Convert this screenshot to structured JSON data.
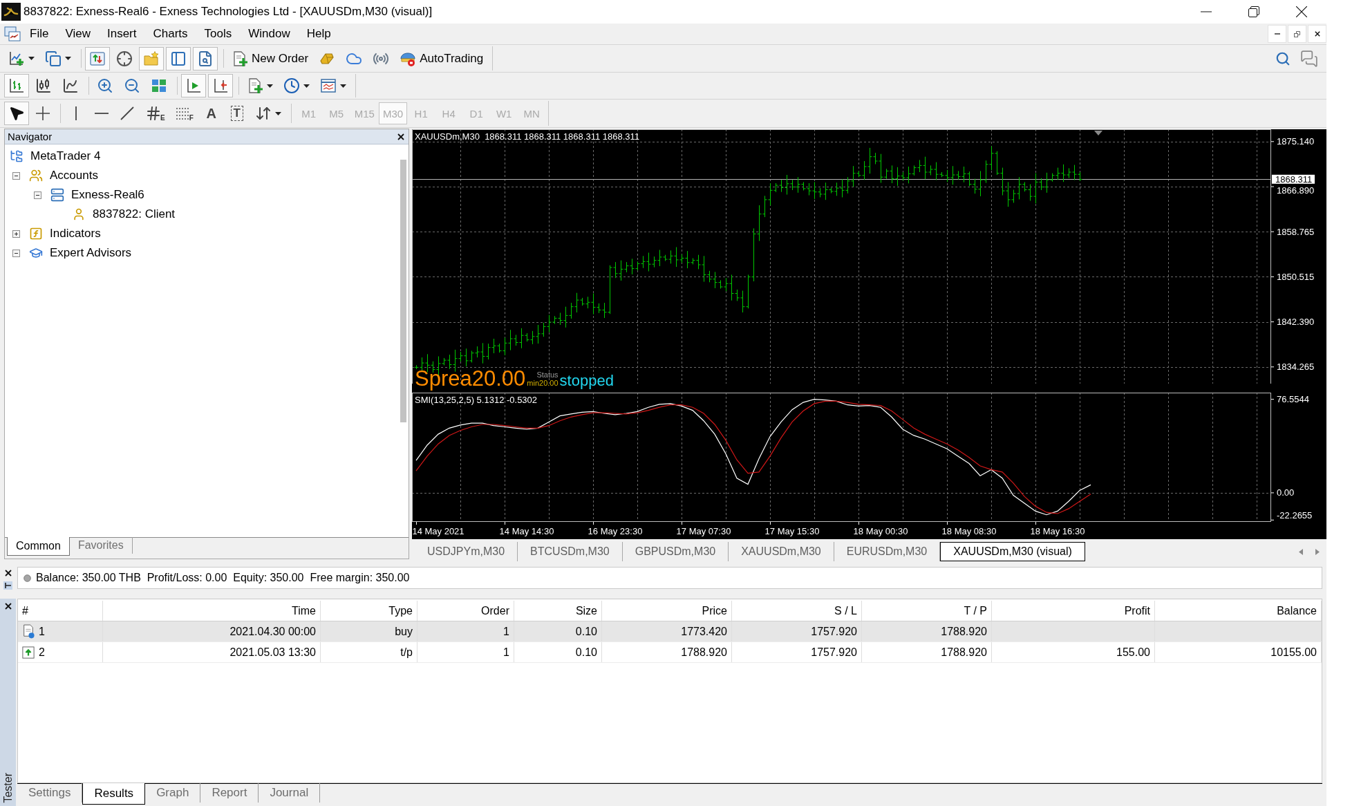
{
  "window": {
    "title": "8837822: Exness-Real6 - Exness Technologies Ltd - [XAUUSDm,M30 (visual)]"
  },
  "menu": [
    "File",
    "View",
    "Insert",
    "Charts",
    "Tools",
    "Window",
    "Help"
  ],
  "toolbars": [
    {
      "groups": [
        [
          {
            "kind": "icon",
            "pressed": false,
            "menu": true
          },
          {
            "kind": "icon",
            "pressed": false,
            "menu": true
          }
        ],
        [
          {
            "kind": "icon",
            "pressed": true
          },
          {
            "kind": "icon",
            "pressed": false
          },
          {
            "kind": "icon",
            "pressed": true
          },
          {
            "kind": "icon",
            "pressed": true
          },
          {
            "kind": "icon",
            "pressed": true
          }
        ],
        [
          {
            "kind": "text",
            "label": "New Order",
            "pressed": false
          },
          {
            "kind": "icon",
            "pressed": false
          },
          {
            "kind": "icon",
            "pressed": false
          },
          {
            "kind": "icon",
            "pressed": false
          },
          {
            "kind": "text",
            "label": "AutoTrading",
            "pressed": false
          }
        ]
      ]
    },
    {
      "groups": [
        [
          {
            "kind": "icon",
            "pressed": true
          },
          {
            "kind": "icon",
            "pressed": false
          },
          {
            "kind": "icon",
            "pressed": false
          }
        ],
        [
          {
            "kind": "icon",
            "pressed": false
          },
          {
            "kind": "icon",
            "pressed": false
          },
          {
            "kind": "icon",
            "pressed": false
          }
        ],
        [
          {
            "kind": "icon",
            "pressed": true
          },
          {
            "kind": "icon",
            "pressed": true
          }
        ],
        [
          {
            "kind": "icon",
            "pressed": false,
            "menu": true
          },
          {
            "kind": "icon",
            "pressed": false,
            "menu": true
          },
          {
            "kind": "icon",
            "pressed": false,
            "menu": true
          }
        ]
      ]
    },
    {
      "groups": [
        [
          {
            "kind": "icon",
            "pressed": true
          },
          {
            "kind": "icon",
            "pressed": false
          }
        ],
        [
          {
            "kind": "icon",
            "pressed": false
          },
          {
            "kind": "icon",
            "pressed": false
          },
          {
            "kind": "icon",
            "pressed": false
          },
          {
            "kind": "sub",
            "label": "E",
            "pressed": false
          },
          {
            "kind": "sub",
            "label": "F",
            "pressed": false
          },
          {
            "kind": "glyph",
            "label": "A",
            "pressed": false
          },
          {
            "kind": "boxed",
            "label": "T",
            "pressed": false
          },
          {
            "kind": "icon",
            "pressed": false,
            "menu": true
          }
        ]
      ],
      "timeframes": [
        {
          "label": "M1",
          "selected": false,
          "disabled": true
        },
        {
          "label": "M5",
          "selected": false,
          "disabled": true
        },
        {
          "label": "M15",
          "selected": false,
          "disabled": true
        },
        {
          "label": "M30",
          "selected": true,
          "disabled": true
        },
        {
          "label": "H1",
          "selected": false,
          "disabled": true
        },
        {
          "label": "H4",
          "selected": false,
          "disabled": true
        },
        {
          "label": "D1",
          "selected": false,
          "disabled": true
        },
        {
          "label": "W1",
          "selected": false,
          "disabled": true
        },
        {
          "label": "MN",
          "selected": false,
          "disabled": true
        }
      ]
    }
  ],
  "navigator": {
    "title": "Navigator",
    "tree": [
      {
        "label": "MetaTrader 4",
        "kind": "terminal",
        "children": [
          {
            "label": "Accounts",
            "kind": "accounts",
            "expanded": true,
            "children": [
              {
                "label": "Exness-Real6",
                "kind": "server",
                "expanded": true,
                "children": [
                  {
                    "label": "8837822: Client",
                    "kind": "account"
                  }
                ]
              }
            ]
          },
          {
            "label": "Indicators",
            "kind": "indicators",
            "expanded": false
          },
          {
            "label": "Expert Advisors",
            "kind": "experts",
            "expanded": true
          }
        ]
      }
    ],
    "tabs": [
      {
        "label": "Common",
        "selected": true
      },
      {
        "label": "Favorites",
        "selected": false
      }
    ]
  },
  "chart": {
    "price": {
      "title": "XAUUSDm,M30  1868.311 1868.311 1868.311 1868.311",
      "axis_labels": [
        "1875.140",
        "1866.890",
        "1858.765",
        "1850.515",
        "1842.390",
        "1834.265"
      ],
      "price_tag": "1868.311"
    },
    "overlay": {
      "spread": [
        "Sprea",
        "20.00"
      ],
      "status_label": "Status",
      "minimum": "min20.00",
      "status": "stopped"
    },
    "indicator": {
      "chart_data": {
        "type": "line",
        "title": "SMI(13,25,2,5) 5.1312 -0.5302",
        "grid": true,
        "ylim": [
          -23.8,
          82.0
        ],
        "yticks": [
          {
            "value": 76.5544,
            "label": "76.5544"
          },
          {
            "value": 0,
            "label": "0.00"
          },
          {
            "value": -22.2655,
            "label": "-22.2655"
          }
        ],
        "categories": [
          null,
          null,
          "14 May 2021",
          null,
          null,
          null,
          null,
          null,
          null,
          null,
          "14 May 14:30",
          null,
          null,
          null,
          null,
          null,
          null,
          null,
          "16 May 23:30",
          null,
          null,
          null,
          null,
          null,
          null,
          null,
          "17 May 07:30",
          null,
          null,
          null,
          null,
          null,
          null,
          null,
          "17 May 15:30",
          null,
          null,
          null,
          null,
          null,
          null,
          null,
          "18 May 00:30",
          null,
          null,
          null,
          null,
          null,
          null,
          null,
          "18 May 08:30",
          null,
          null,
          null,
          null,
          null,
          null,
          null,
          "18 May 16:30",
          null,
          null,
          null,
          null,
          null,
          null,
          null,
          null,
          null,
          null,
          null,
          null,
          null,
          null,
          null,
          null,
          null,
          null,
          null
        ],
        "series": [
          {
            "color": "#ffffff",
            "values": [
              26.5,
              39,
              48,
              53,
              55.5,
              57,
              57,
              55,
              54,
              53,
              52,
              53,
              58,
              63,
              64.5,
              66,
              66.5,
              65,
              64,
              65,
              66.5,
              70,
              72.5,
              73,
              71,
              67.5,
              59,
              48,
              32,
              12,
              7,
              28,
              46,
              58,
              68,
              74,
              76.5,
              76,
              75,
              72,
              71,
              71.5,
              70,
              62,
              52,
              47,
              44,
              40,
              36,
              30,
              24,
              14,
              19,
              12,
              -2,
              -8.5,
              -15,
              -18,
              -15,
              -7,
              2,
              6.5,
              null,
              null,
              null,
              null,
              null,
              null,
              null,
              null,
              null,
              null,
              null,
              null,
              null,
              null,
              null,
              null
            ]
          },
          {
            "color": "#d01818",
            "values": [
              18,
              30,
              40,
              47,
              51,
              54,
              56,
              56,
              55,
              54,
              53,
              53,
              55,
              59,
              62,
              64,
              65.5,
              65.5,
              65,
              64.5,
              65.5,
              67.5,
              70,
              72,
              72,
              70,
              65,
              56,
              43,
              27,
              16,
              17,
              30,
              45,
              58,
              67,
              73,
              75,
              75,
              74,
              72.5,
              72,
              71.5,
              67,
              60,
              53,
              48,
              44,
              40,
              35,
              29,
              22,
              19,
              17,
              8,
              -3,
              -11,
              -16,
              -17,
              -13,
              -7,
              -1,
              null,
              null,
              null,
              null,
              null,
              null,
              null,
              null,
              null,
              null,
              null,
              null,
              null,
              null,
              null,
              null
            ]
          }
        ]
      }
    }
  },
  "chart_tabs": [
    {
      "label": "USDJPYm,M30",
      "selected": false
    },
    {
      "label": "BTCUSDm,M30",
      "selected": false
    },
    {
      "label": "GBPUSDm,M30",
      "selected": false
    },
    {
      "label": "XAUUSDm,M30",
      "selected": false
    },
    {
      "label": "EURUSDm,M30",
      "selected": false
    },
    {
      "label": "XAUUSDm,M30 (visual)",
      "selected": true
    }
  ],
  "terminal": {
    "balance": "Balance: 350.00 THB  Profit/Loss: 0.00  Equity: 350.00  Free margin: 350.00"
  },
  "tester": {
    "title": "Tester",
    "columns": [
      "#",
      "Time",
      "Type",
      "Order",
      "Size",
      "Price",
      "S / L",
      "T / P",
      "Profit",
      "Balance"
    ],
    "rows": [
      {
        "kind": "entry",
        "selected": true,
        "number": "1",
        "time": "2021.04.30 00:00",
        "type": "buy",
        "order": "1",
        "size": "0.10",
        "price": "1773.420",
        "sl": "1757.920",
        "tp": "1788.920"
      },
      {
        "kind": "exit",
        "selected": false,
        "number": "2",
        "time": "2021.05.03 13:30",
        "type": "t/p",
        "order": "1",
        "size": "0.10",
        "price": "1788.920",
        "sl": "1757.920",
        "tp": "1788.920",
        "profit": "155.00",
        "balance": "10155.00"
      }
    ],
    "tabs": [
      {
        "label": "Settings",
        "selected": false
      },
      {
        "label": "Results",
        "selected": true
      },
      {
        "label": "Graph",
        "selected": false
      },
      {
        "label": "Report",
        "selected": false
      },
      {
        "label": "Journal",
        "selected": false
      }
    ]
  }
}
